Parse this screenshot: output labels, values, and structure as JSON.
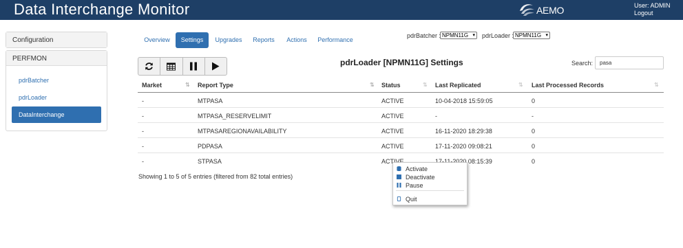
{
  "header": {
    "title": "Data Interchange Monitor",
    "logo_text": "AEMO",
    "user_label": "User: ADMIN",
    "logout_label": "Logout"
  },
  "sidebar": {
    "configuration": "Configuration",
    "section": "PERFMON",
    "items": [
      {
        "label": "pdrBatcher",
        "active": false
      },
      {
        "label": "pdrLoader",
        "active": false
      },
      {
        "label": "DataInterchange",
        "active": true
      }
    ]
  },
  "tabs": [
    {
      "label": "Overview",
      "active": false
    },
    {
      "label": "Settings",
      "active": true
    },
    {
      "label": "Upgrades",
      "active": false
    },
    {
      "label": "Reports",
      "active": false
    },
    {
      "label": "Actions",
      "active": false
    },
    {
      "label": "Performance",
      "active": false
    }
  ],
  "selectors": {
    "batcher_label": "pdrBatcher :",
    "batcher_value": "NPMN11G",
    "loader_label": "pdrLoader :",
    "loader_value": "NPMN11G"
  },
  "toolbar": {
    "buttons": [
      "refresh-icon",
      "grid-icon",
      "pause-icon",
      "play-icon"
    ]
  },
  "page_title": "pdrLoader [NPMN11G] Settings",
  "search": {
    "label": "Search:",
    "value": "pasa"
  },
  "table": {
    "columns": [
      "Market",
      "Report Type",
      "Status",
      "Last Replicated",
      "Last Processed Records"
    ],
    "rows": [
      [
        "-",
        "MTPASA",
        "ACTIVE",
        "10-04-2018 15:59:05",
        "0"
      ],
      [
        "-",
        "MTPASA_RESERVELIMIT",
        "ACTIVE",
        "-",
        "-"
      ],
      [
        "-",
        "MTPASAREGIONAVAILABILITY",
        "ACTIVE",
        "16-11-2020 18:29:38",
        "0"
      ],
      [
        "-",
        "PDPASA",
        "ACTIVE",
        "17-11-2020 09:08:21",
        "0"
      ],
      [
        "-",
        "STPASA",
        "ACTIVE",
        "17-11-2020 08:15:39",
        "0"
      ]
    ]
  },
  "footer_info": "Showing 1 to 5 of 5 entries (filtered from 82 total entries)",
  "context_menu": {
    "items": [
      {
        "label": "Activate",
        "icon": "database-icon"
      },
      {
        "label": "Deactivate",
        "icon": "stop-icon"
      },
      {
        "label": "Pause",
        "icon": "pause-icon"
      },
      {
        "label": "Quit",
        "icon": "mobile-icon"
      }
    ]
  },
  "colors": {
    "header_bg": "#1e3f66",
    "accent": "#2f6fb0"
  }
}
